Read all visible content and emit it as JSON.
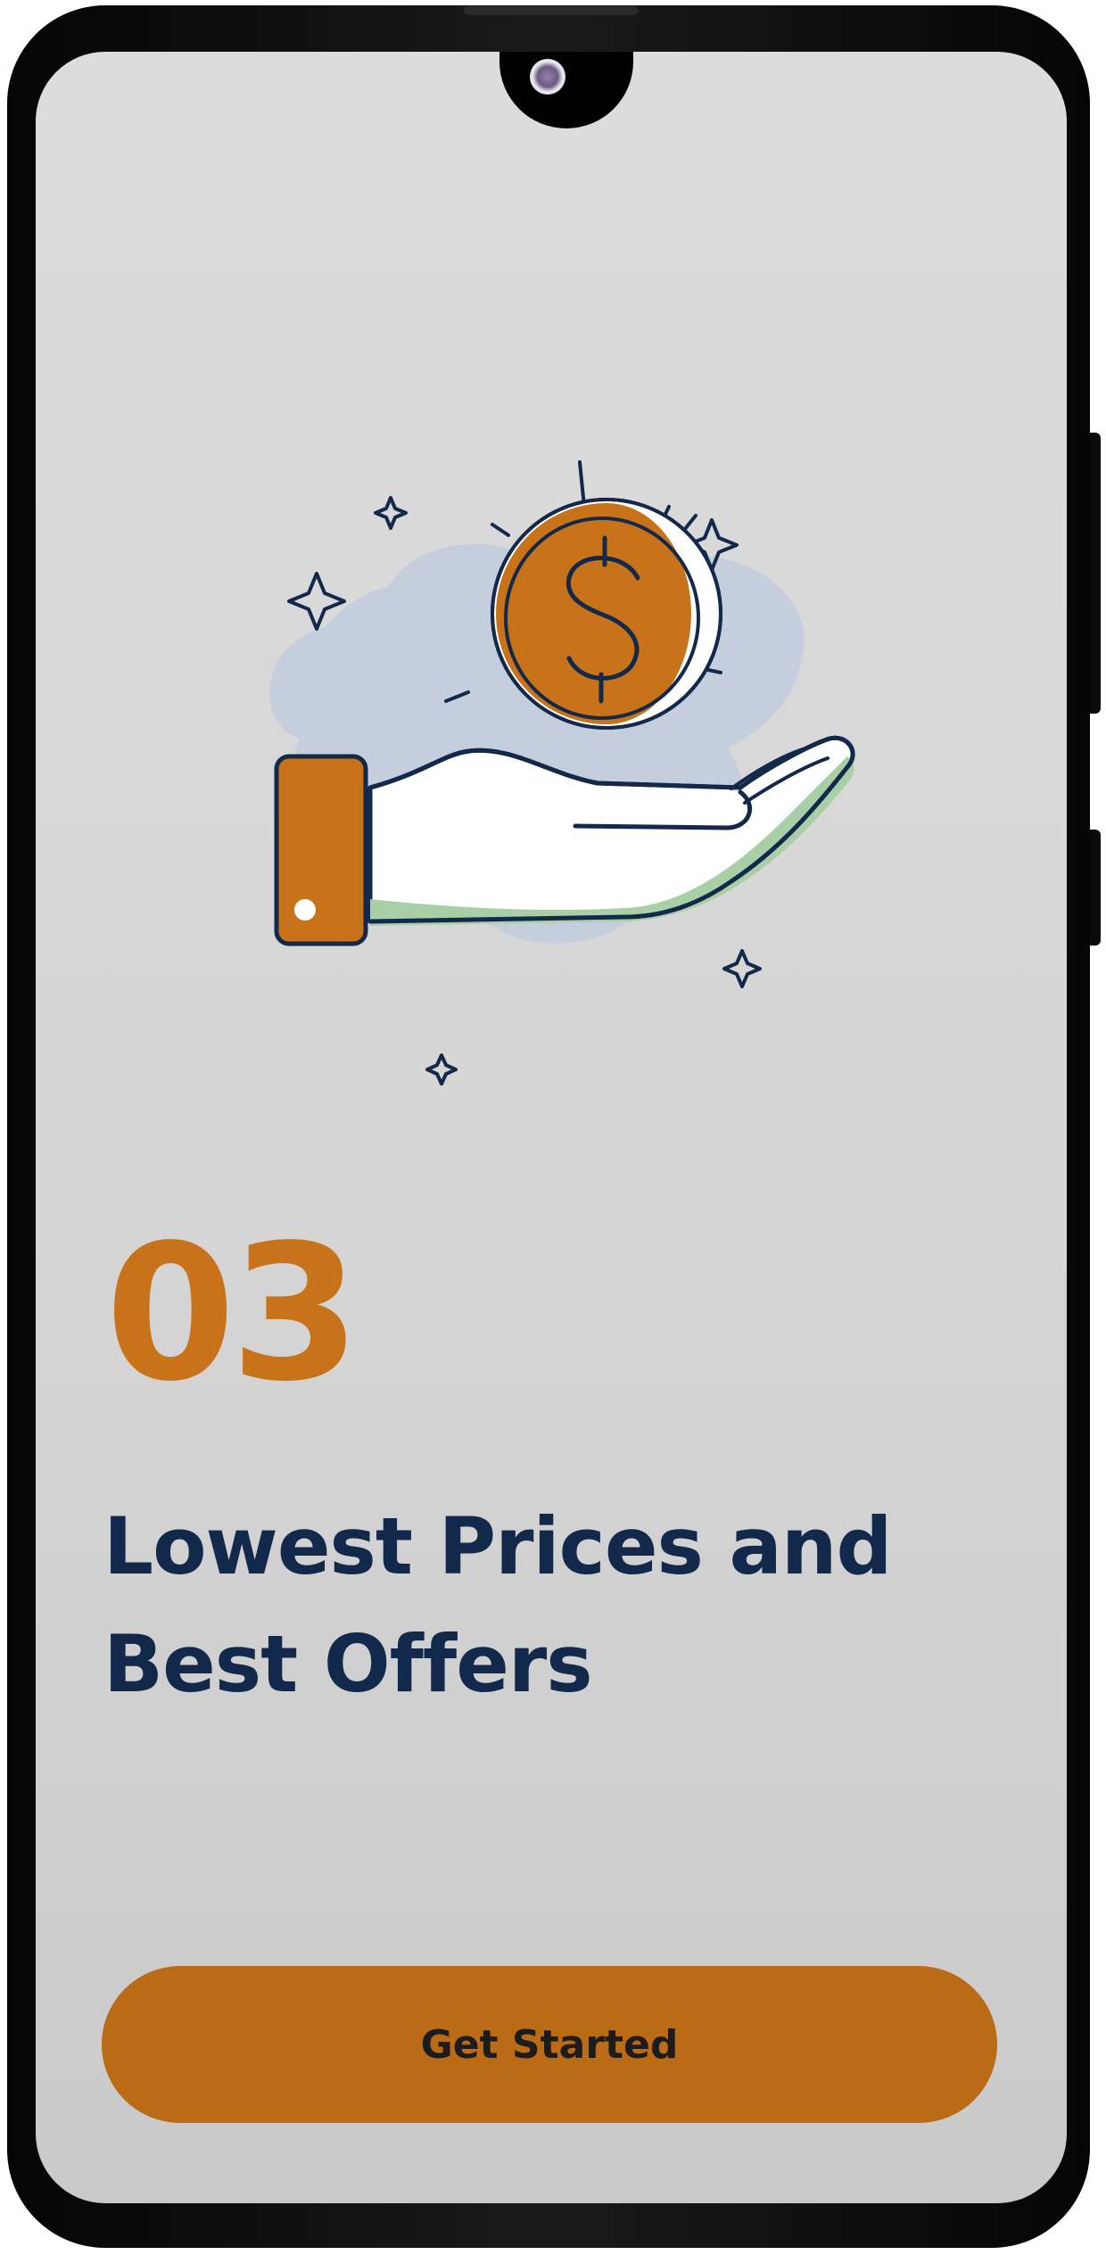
{
  "onboarding": {
    "step_number": "03",
    "headline_line1": "Lowest Prices and",
    "headline_line2": "Best Offers",
    "cta_label": "Get Started"
  },
  "illustration": {
    "icons": [
      "hand-icon",
      "dollar-coin-icon",
      "sparkle-icon"
    ]
  },
  "colors": {
    "accent": "#c8731a",
    "button": "#bb6a16",
    "headline": "#13294b",
    "screen_bg": "#d9d9d9",
    "blob": "#c5cedc",
    "hand_stripe": "#a9cfa6"
  }
}
